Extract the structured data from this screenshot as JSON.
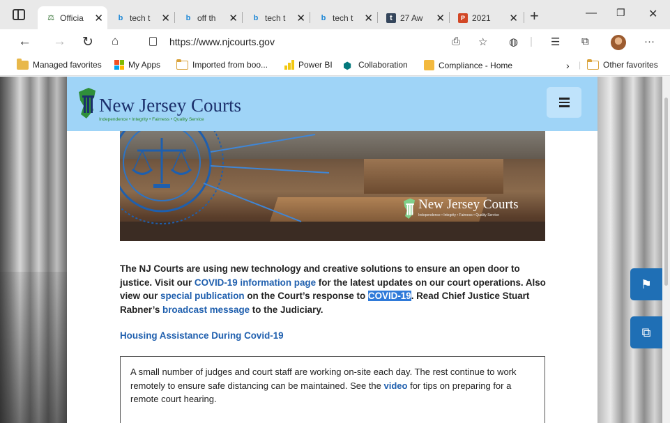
{
  "browser": {
    "tabs": [
      {
        "title": "Officia",
        "icon": "njcourts-favicon",
        "active": true
      },
      {
        "title": "tech t",
        "icon": "bing-icon"
      },
      {
        "title": "off th",
        "icon": "bing-icon"
      },
      {
        "title": "tech t",
        "icon": "bing-icon"
      },
      {
        "title": "tech t",
        "icon": "bing-icon"
      },
      {
        "title": "27 Aw",
        "icon": "tumblr-icon"
      },
      {
        "title": "2021",
        "icon": "powerpoint-icon"
      }
    ],
    "url": "https://www.njcourts.gov",
    "favorites": {
      "managed": "Managed favorites",
      "apps": "My Apps",
      "imported": "Imported from boo...",
      "powerbi": "Power BI",
      "collaboration": "Collaboration",
      "compliance": "Compliance - Home",
      "other": "Other favorites"
    }
  },
  "site": {
    "logo_title": "New Jersey Courts",
    "logo_tagline": "Independence • Integrity • Fairness • Quality Service",
    "hero_logo_title": "New Jersey Courts",
    "hero_logo_tagline": "Independence • Integrity • Fairness • Quality Service",
    "intro": {
      "p1": "The NJ Courts are using new technology and creative solutions to ensure an open door to justice. Visit our ",
      "link1": "COVID-19 information page",
      "p2": " for the latest updates on our court operations. Also view our ",
      "link2": "special publication",
      "p3": " on the Court’s response to ",
      "highlight": "COVID-19",
      "p4": ". Read Chief Justice Stuart Rabner’s ",
      "link3": "broadcast message",
      "p5": " to the Judiciary."
    },
    "housing_link": "Housing Assistance During Covid-19",
    "notice": {
      "p1": "A small number of judges and court staff are working on-site each day. The rest continue to work remotely to ensure safe distancing can be maintained. See the ",
      "link": "video",
      "p2": " for tips on preparing for a remote court hearing."
    }
  },
  "colors": {
    "header_bg": "#9fd4f7",
    "link": "#1f5fae",
    "side_button": "#1f6fb5"
  }
}
